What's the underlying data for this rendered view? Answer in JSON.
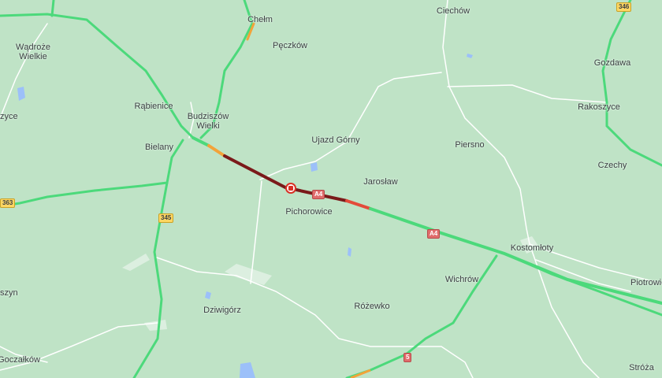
{
  "map": {
    "colors": {
      "background": "#bfe3c6",
      "road_green": "#4cd97b",
      "road_orange": "#f2a33a",
      "road_red": "#e34b3a",
      "road_darkred": "#7a1a1a",
      "minor_road": "#ffffff",
      "water": "#9cc0f9"
    },
    "places": [
      {
        "name": "Chełm"
      },
      {
        "name": "Ciechów"
      },
      {
        "name": "Wądroże\nWielkie"
      },
      {
        "name": "Pęczków"
      },
      {
        "name": "Gozdawa"
      },
      {
        "name": "Rąbienice"
      },
      {
        "name": "Budziszów\nWielki"
      },
      {
        "name": "zyce"
      },
      {
        "name": "Rakoszyce"
      },
      {
        "name": "Bielany"
      },
      {
        "name": "Ujazd Górny"
      },
      {
        "name": "Piersno"
      },
      {
        "name": "Czechy"
      },
      {
        "name": "Jarosław"
      },
      {
        "name": "Pichorowice"
      },
      {
        "name": "Kostomłoty"
      },
      {
        "name": "Piotrowic"
      },
      {
        "name": "Wichrów"
      },
      {
        "name": "szyn"
      },
      {
        "name": "Dziwigórz"
      },
      {
        "name": "Różewko"
      },
      {
        "name": "Goczałków"
      },
      {
        "name": "Stróża"
      }
    ],
    "shields": [
      {
        "label": "346",
        "style": "yellow"
      },
      {
        "label": "363",
        "style": "yellow"
      },
      {
        "label": "345",
        "style": "yellow"
      },
      {
        "label": "A4",
        "style": "red"
      },
      {
        "label": "A4",
        "style": "red"
      },
      {
        "label": "5",
        "style": "red"
      }
    ],
    "incident": {
      "icon": "road-closure-icon"
    }
  }
}
